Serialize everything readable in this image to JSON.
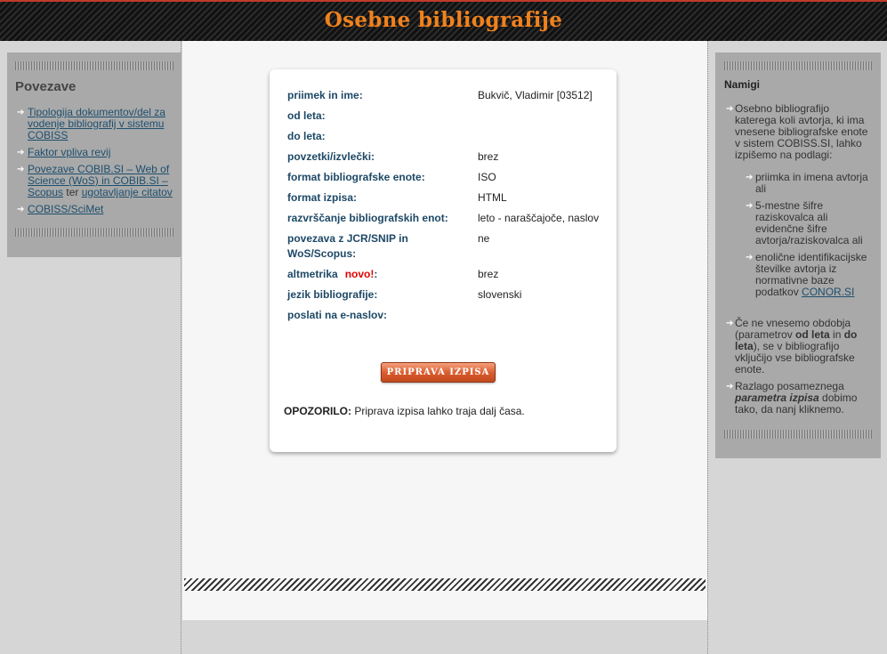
{
  "header": {
    "title": "Osebne bibliografije"
  },
  "sidebar_left": {
    "title": "Povezave",
    "links": [
      {
        "label": "Tipologija dokumentov/del za vodenje bibliografij v sistemu COBISS"
      },
      {
        "label": "Faktor vpliva revij"
      },
      {
        "label": "Povezave COBIB.SI – Web of Science (WoS) in COBIB.SI – Scopus",
        "connector": "ter",
        "label2": "ugotavljanje citatov"
      },
      {
        "label": "COBISS/SciMet"
      }
    ]
  },
  "form": {
    "rows": [
      {
        "label": "priimek in ime:",
        "value": "Bukvič, Vladimir [03512]"
      },
      {
        "label": "od leta:",
        "value": ""
      },
      {
        "label": "do leta:",
        "value": ""
      },
      {
        "label": "povzetki/izvlečki:",
        "value": "brez"
      },
      {
        "label": "format bibliografske enote:",
        "value": "ISO"
      },
      {
        "label": "format izpisa:",
        "value": "HTML"
      },
      {
        "label": "razvrščanje bibliografskih enot:",
        "value": "leto - naraščajoče, naslov"
      },
      {
        "label": "povezava z JCR/SNIP in WoS/Scopus:",
        "value": "ne"
      },
      {
        "label": "altmetrika",
        "badge": "novo!",
        "suffix": ":",
        "value": "brez"
      },
      {
        "label": "jezik bibliografije:",
        "value": "slovenski"
      },
      {
        "label": "poslati na e-naslov:",
        "value": ""
      }
    ],
    "submit_label": "PRIPRAVA IZPISA",
    "warning_label": "OPOZORILO:",
    "warning_text": " Priprava izpisa lahko traja dalj časa."
  },
  "sidebar_right": {
    "title": "Namigi",
    "intro": "Osebno bibliografijo katerega koli avtorja, ki ima vnesene bibliografske enote v sistem COBISS.SI, lahko izpišemo na podlagi:",
    "sub_items": [
      {
        "text": "priimka in imena avtorja ali"
      },
      {
        "text": "5-mestne šifre raziskovalca ali evidenčne šifre avtorja/raziskovalca ali"
      },
      {
        "text": "enolične identifikacijske številke avtorja iz normativne baze podatkov ",
        "link": "CONOR.SI"
      }
    ],
    "hint2": {
      "t1": "Če ne vnesemo obdobja (parametrov ",
      "b1": "od leta",
      "t2": " in ",
      "b2": "do leta",
      "t3": "), se v bibliografijo vključijo vse bibliografske enote."
    },
    "hint3": {
      "t1": "Razlago posameznega ",
      "b1": "parametra izpisa",
      "t2": " dobimo tako, da nanj kliknemo."
    }
  },
  "colors": {
    "accent_orange": "#f0821e",
    "header_bg": "#1a1a1a",
    "label_blue": "#1d4866",
    "new_red": "#e00000",
    "button_orange": "#d85a2c"
  }
}
